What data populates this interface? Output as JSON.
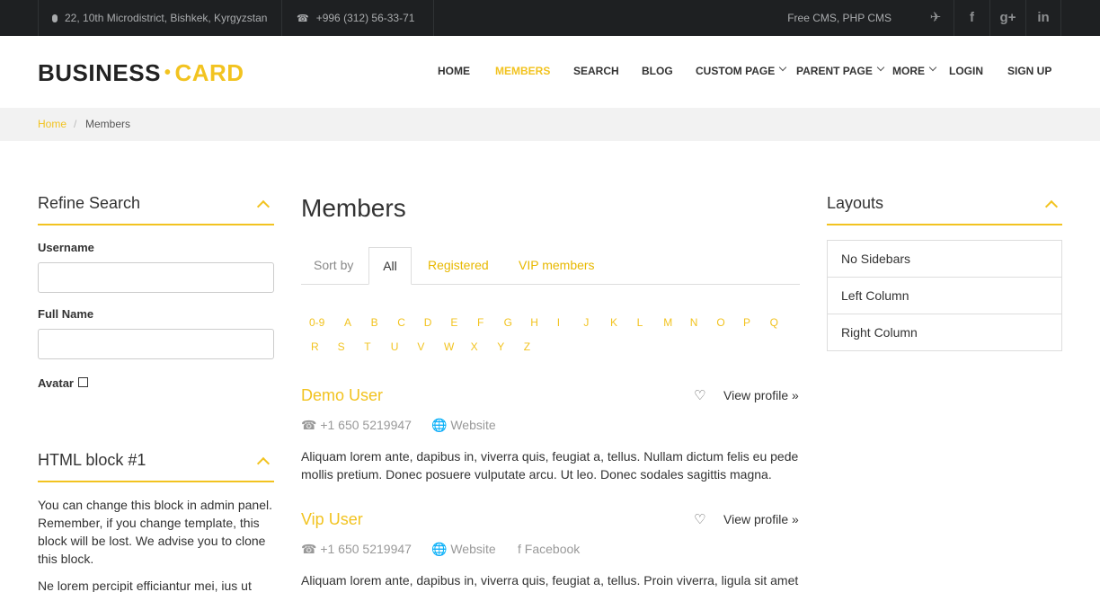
{
  "topbar": {
    "address": "22, 10th Microdistrict, Bishkek, Kyrgyzstan",
    "phone": "+996 (312) 56-33-71",
    "cms": "Free CMS, PHP CMS",
    "social": [
      "twitter-icon",
      "facebook-icon",
      "google-plus-icon",
      "linkedin-icon"
    ],
    "social_glyphs": {
      "twitter": "✈",
      "facebook": "f",
      "google": "g+",
      "linkedin": "in"
    }
  },
  "logo": {
    "part1": "BUSINESS",
    "dot": "•",
    "part2": "CARD"
  },
  "nav": {
    "home": "HOME",
    "members": "MEMBERS",
    "search": "SEARCH",
    "blog": "BLOG",
    "custom_page": "CUSTOM PAGE",
    "parent_page": "PARENT PAGE",
    "more": "MORE",
    "login": "LOGIN",
    "signup": "SIGN UP"
  },
  "breadcrumb": {
    "home": "Home",
    "sep": "/",
    "current": "Members"
  },
  "refine": {
    "title": "Refine Search",
    "username_label": "Username",
    "fullname_label": "Full Name",
    "avatar_label": "Avatar"
  },
  "html_block": {
    "title": "HTML block #1",
    "text": "You can change this block in admin panel. Remember, if you change template, this block will be lost. We advise you to clone this block.",
    "text2": "Ne lorem percipit efficiantur mei, ius ut"
  },
  "members": {
    "title": "Members",
    "sort_by": "Sort by",
    "tabs": {
      "all": "All",
      "registered": "Registered",
      "vip": "VIP members"
    },
    "alphabet_row1": [
      "0-9",
      "A",
      "B",
      "C",
      "D",
      "E",
      "F",
      "G",
      "H",
      "I",
      "J",
      "K",
      "L",
      "M",
      "N",
      "O",
      "P",
      "Q"
    ],
    "alphabet_row2": [
      "R",
      "S",
      "T",
      "U",
      "V",
      "W",
      "X",
      "Y",
      "Z"
    ],
    "list": [
      {
        "name": "Demo User",
        "view_profile": "View profile »",
        "phone": "+1 650 5219947",
        "website": "Website",
        "description": "Aliquam lorem ante, dapibus in, viverra quis, feugiat a, tellus. Nullam dictum felis eu pede mollis pretium. Donec posuere vulputate arcu. Ut leo. Donec sodales sagittis magna."
      },
      {
        "name": "Vip User",
        "view_profile": "View profile »",
        "phone": "+1 650 5219947",
        "website": "Website",
        "facebook": "Facebook",
        "description": "Aliquam lorem ante, dapibus in, viverra quis, feugiat a, tellus. Proin viverra, ligula sit amet"
      }
    ]
  },
  "layouts": {
    "title": "Layouts",
    "items": [
      "No Sidebars",
      "Left Column",
      "Right Column"
    ]
  },
  "colors": {
    "accent": "#f2c320",
    "topbar": "#1e2022"
  }
}
